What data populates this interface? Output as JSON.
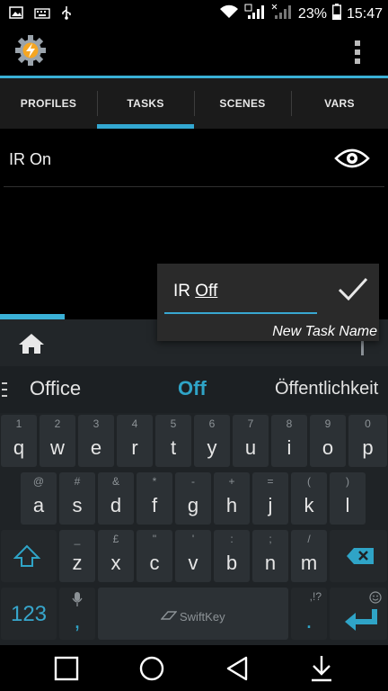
{
  "status_bar": {
    "battery_percent": "23%",
    "time": "15:47"
  },
  "tabs": [
    {
      "label": "PROFILES",
      "active": false
    },
    {
      "label": "TASKS",
      "active": true
    },
    {
      "label": "SCENES",
      "active": false
    },
    {
      "label": "VARS",
      "active": false
    }
  ],
  "task_list": [
    {
      "name": "IR On"
    }
  ],
  "dialog": {
    "input_prefix": "IR ",
    "input_word": "Off",
    "hint": "New Task Name"
  },
  "suggestions": [
    "Office",
    "Off",
    "Öffentlichkeit"
  ],
  "keyboard": {
    "row1": [
      {
        "alt": "1",
        "main": "q"
      },
      {
        "alt": "2",
        "main": "w"
      },
      {
        "alt": "3",
        "main": "e"
      },
      {
        "alt": "4",
        "main": "r"
      },
      {
        "alt": "5",
        "main": "t"
      },
      {
        "alt": "6",
        "main": "y"
      },
      {
        "alt": "7",
        "main": "u"
      },
      {
        "alt": "8",
        "main": "i"
      },
      {
        "alt": "9",
        "main": "o"
      },
      {
        "alt": "0",
        "main": "p"
      }
    ],
    "row2": [
      {
        "alt": "@",
        "main": "a"
      },
      {
        "alt": "#",
        "main": "s"
      },
      {
        "alt": "&",
        "main": "d"
      },
      {
        "alt": "*",
        "main": "f"
      },
      {
        "alt": "-",
        "main": "g"
      },
      {
        "alt": "+",
        "main": "h"
      },
      {
        "alt": "=",
        "main": "j"
      },
      {
        "alt": "(",
        "main": "k"
      },
      {
        "alt": ")",
        "main": "l"
      }
    ],
    "row3": [
      {
        "alt": "_",
        "main": "z"
      },
      {
        "alt": "£",
        "main": "x"
      },
      {
        "alt": "\"",
        "main": "c"
      },
      {
        "alt": "'",
        "main": "v"
      },
      {
        "alt": ":",
        "main": "b"
      },
      {
        "alt": ";",
        "main": "n"
      },
      {
        "alt": "/",
        "main": "m"
      }
    ],
    "mode_label": "123",
    "comma": ",",
    "period": ".",
    "period_alt": ",!?",
    "brand": "SwiftKey"
  },
  "colors": {
    "accent": "#33a8d2",
    "keyboard_bg": "#1f2326",
    "key_bg": "#2c3135"
  }
}
